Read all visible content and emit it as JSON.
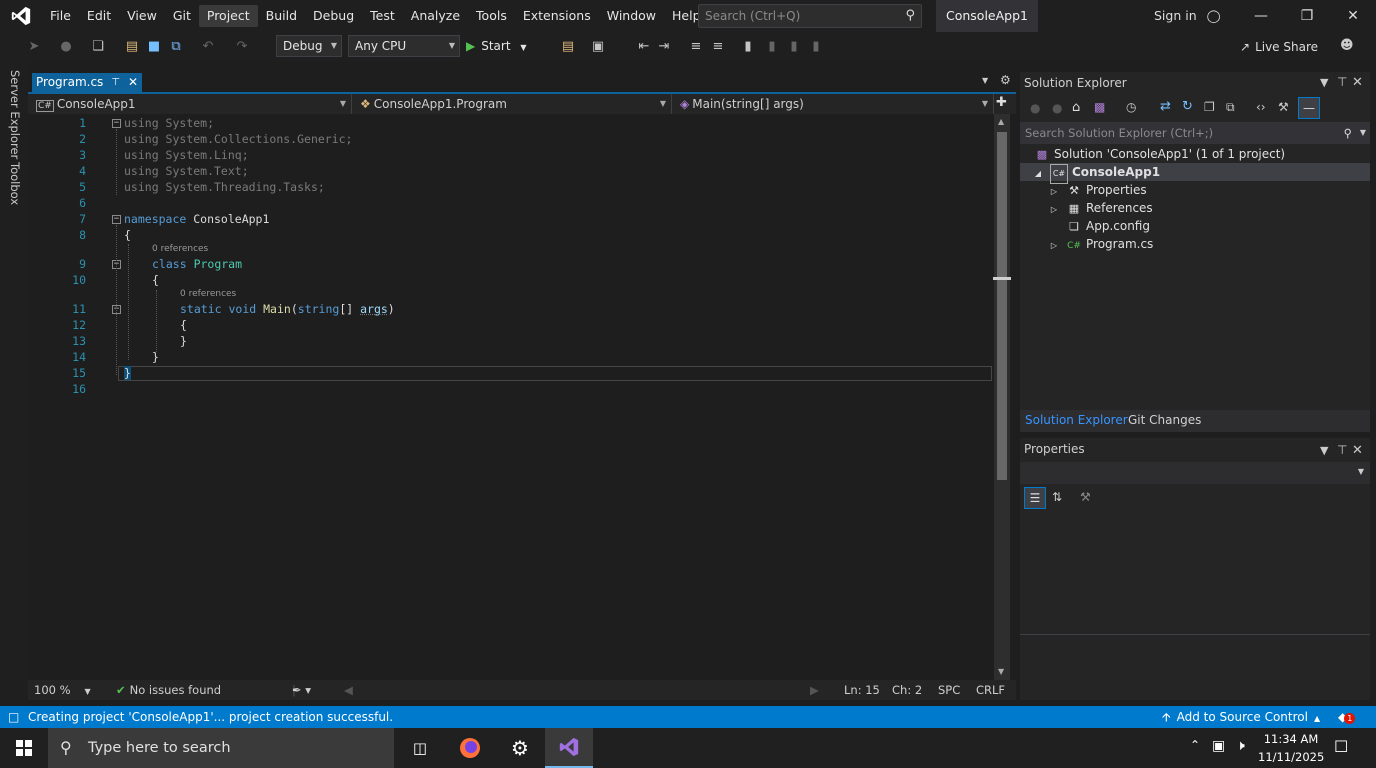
{
  "menu": {
    "items": [
      "File",
      "Edit",
      "View",
      "Git",
      "Project",
      "Build",
      "Debug",
      "Test",
      "Analyze",
      "Tools",
      "Extensions",
      "Window",
      "Help"
    ],
    "highlighted": "Project",
    "search_placeholder": "Search (Ctrl+Q)",
    "solution_name": "ConsoleApp1",
    "sign_in": "Sign in"
  },
  "toolbar": {
    "config": "Debug",
    "platform": "Any CPU",
    "start": "Start",
    "live_share": "Live Share"
  },
  "side_tabs": [
    "Server Explorer",
    "Toolbox"
  ],
  "editor": {
    "tab_label": "Program.cs",
    "nav": {
      "project": "ConsoleApp1",
      "class": "ConsoleApp1.Program",
      "member": "Main(string[] args)"
    },
    "line_numbers": [
      "1",
      "2",
      "3",
      "4",
      "5",
      "6",
      "7",
      "8",
      "9",
      "10",
      "11",
      "12",
      "13",
      "14",
      "15",
      "16"
    ],
    "lens_text": "0 references",
    "code": {
      "l1_kw": "using",
      "l1_ns": " System;",
      "l2_kw": "using",
      "l2_ns": " System.Collections.Generic;",
      "l3_kw": "using",
      "l3_ns": " System.Linq;",
      "l4_kw": "using",
      "l4_ns": " System.Text;",
      "l5_kw": "using",
      "l5_ns": " System.Threading.Tasks;",
      "l7_kw": "namespace",
      "l7_name": " ConsoleApp1",
      "open_brace": "{",
      "close_brace": "}",
      "l9_kw": "class",
      "l9_name": "Program",
      "l11_kw1": "static",
      "l11_kw2": "void",
      "l11_fn": "Main",
      "l11_kw3": "string",
      "l11_arr": "[] ",
      "l11_pm": "args",
      "l11_close": ")",
      "paren_open": "("
    },
    "status": {
      "zoom": "100 %",
      "issues": "No issues found",
      "line": "Ln: 15",
      "col": "Ch: 2",
      "spc": "SPC",
      "eol": "CRLF"
    }
  },
  "solution_explorer": {
    "title": "Solution Explorer",
    "search_placeholder": "Search Solution Explorer (Ctrl+;)",
    "solution": "Solution 'ConsoleApp1' (1 of 1 project)",
    "project": "ConsoleApp1",
    "items": [
      "Properties",
      "References",
      "App.config",
      "Program.cs"
    ],
    "tabs": [
      "Solution Explorer",
      "Git Changes"
    ]
  },
  "properties": {
    "title": "Properties"
  },
  "statusbar": {
    "message": "Creating project 'ConsoleApp1'... project creation successful.",
    "source_control": "Add to Source Control",
    "notifications": "1"
  },
  "taskbar": {
    "search_placeholder": "Type here to search",
    "time": "11:34 AM",
    "date": "11/11/2025"
  },
  "colors": {
    "accent": "#007acc",
    "keyword": "#569cd6",
    "type": "#4ec9b0",
    "line_number": "#2b91af"
  }
}
